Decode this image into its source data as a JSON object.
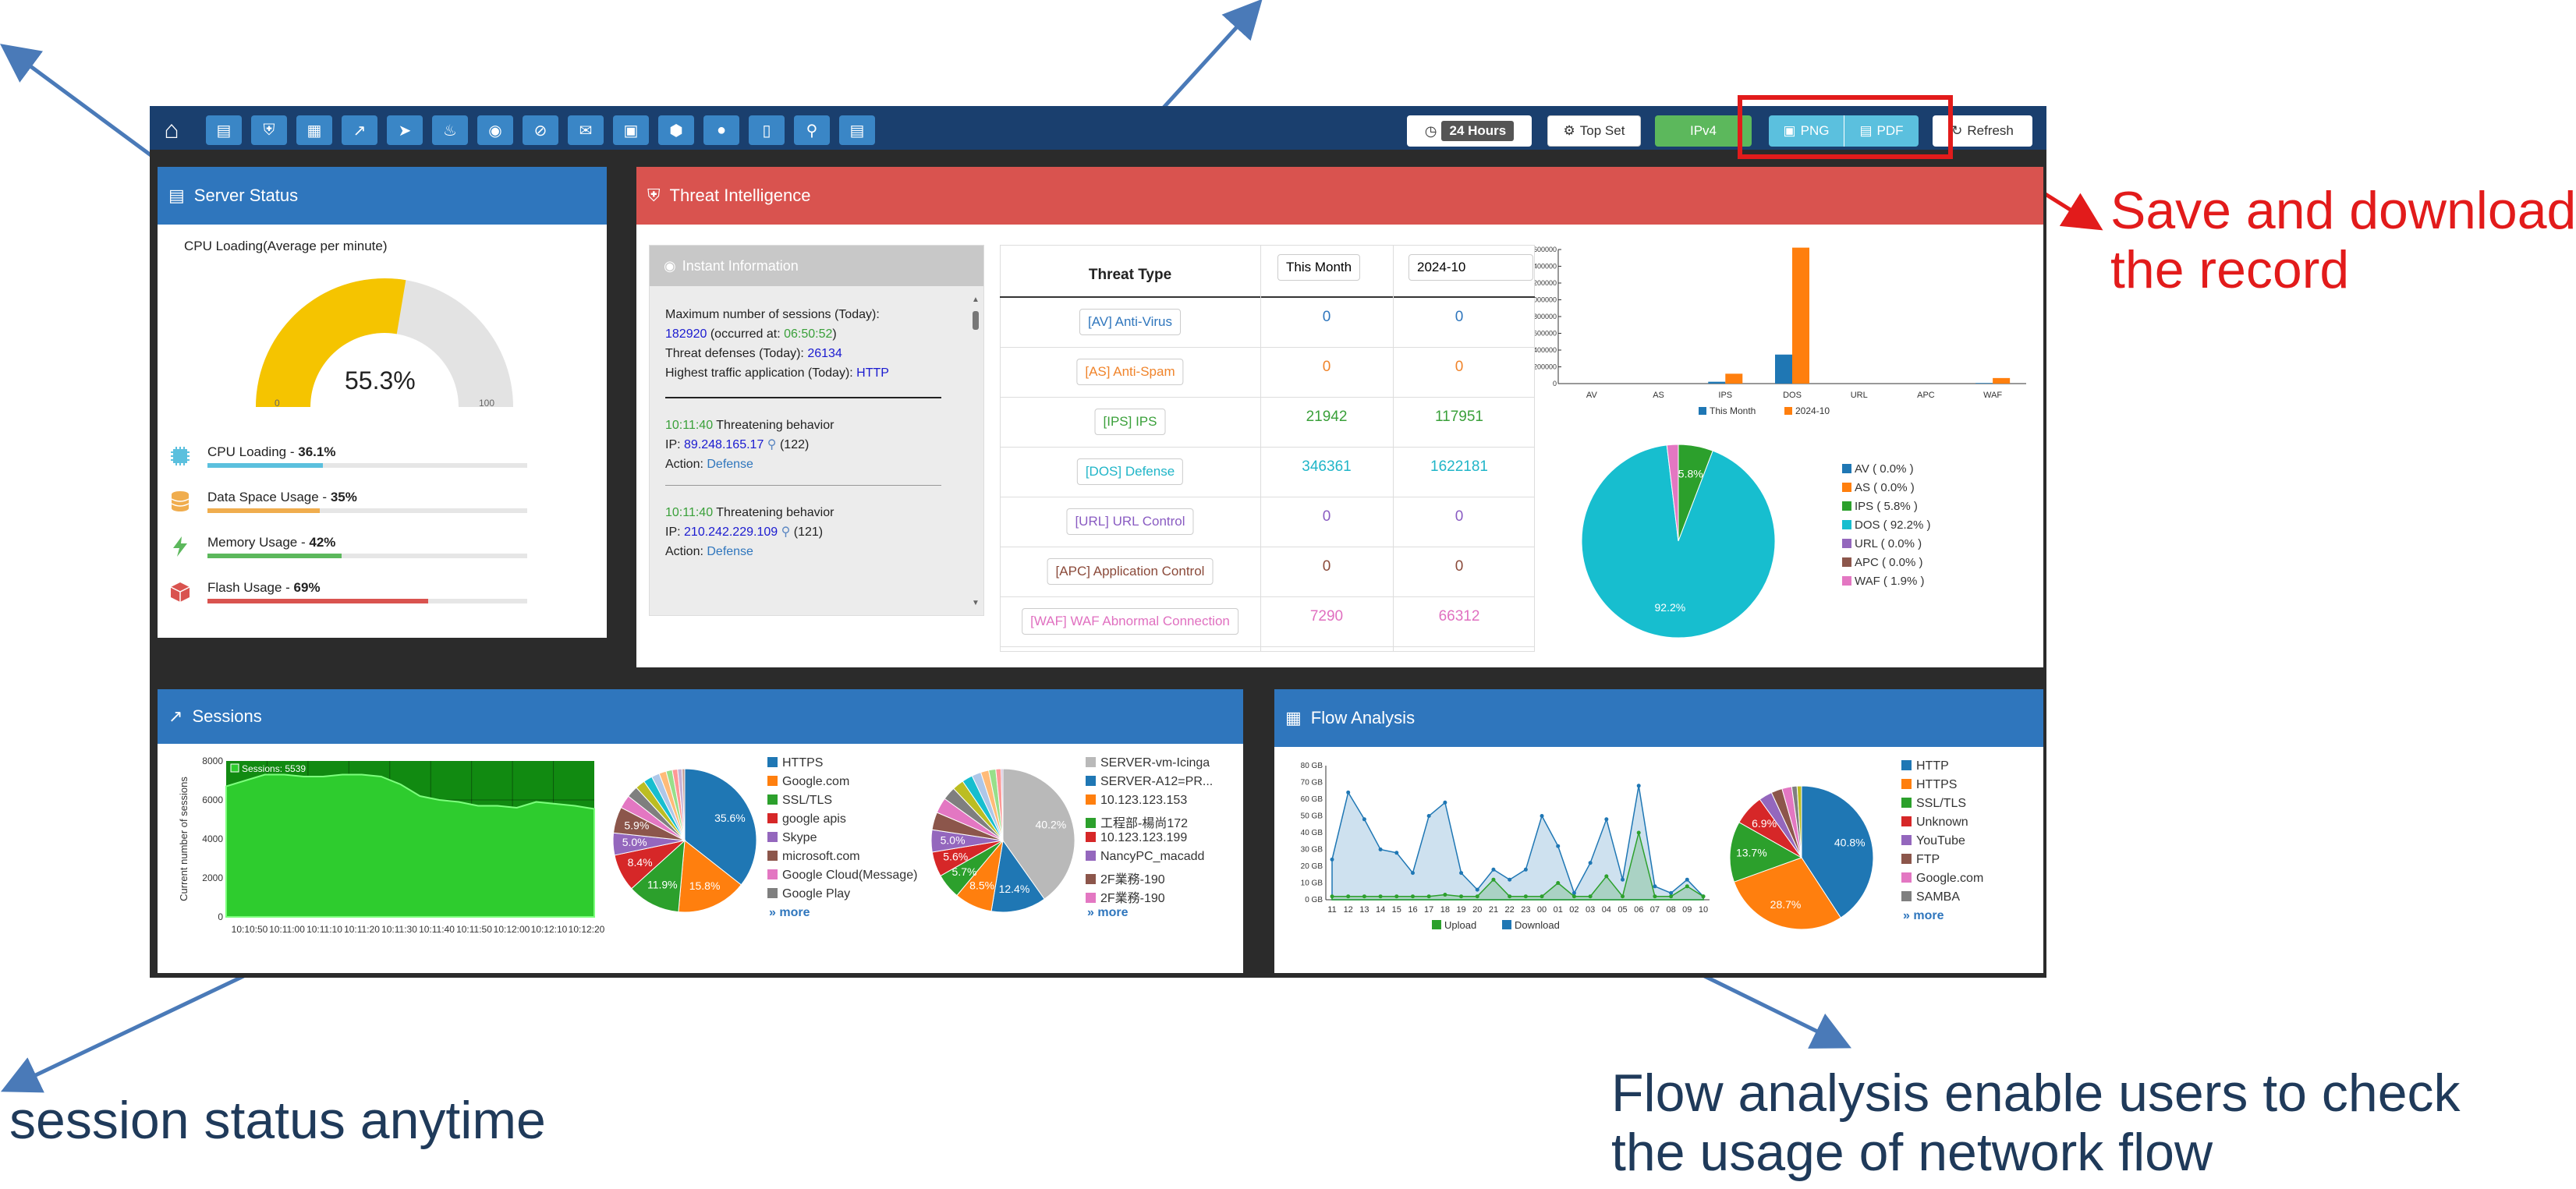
{
  "annotations": {
    "save_download": "Save and download\nthe record",
    "session_status": "session status anytime",
    "flow_analysis": "Flow analysis enable users to check\nthe usage of network flow"
  },
  "colors": {
    "annotation_red": "#e21b1b",
    "annotation_blue": "#1f3a5a",
    "arrow_blue": "#4a7ab8",
    "navbar": "#1a3f6e",
    "panel_blue": "#2f76bd",
    "panel_red": "#d9534f"
  },
  "toolbar": {
    "icons": [
      "home-icon",
      "server-icon",
      "shield-icon",
      "grid-icon",
      "chart-icon",
      "rocket-icon",
      "fire-icon",
      "globe-icon",
      "eye-slash-icon",
      "mail-icon",
      "box-icon",
      "cube-icon",
      "map-marker-icon",
      "map-icon",
      "search-icon",
      "file-icon"
    ],
    "time_label": "24 Hours",
    "top_set_label": "Top Set",
    "ipv4_label": "IPv4",
    "png_label": "PNG",
    "pdf_label": "PDF",
    "refresh_label": "Refresh"
  },
  "server_status": {
    "title": "Server Status",
    "gauge_caption": "CPU Loading(Average per minute)",
    "gauge_value": "55.3%",
    "gauge_fraction": 0.553,
    "gauge_min": "0",
    "gauge_max": "100",
    "metrics": [
      {
        "label": "CPU Loading - ",
        "value": "36.1%",
        "fraction": 0.361,
        "color": "#5bc0de",
        "icon": "chip-icon"
      },
      {
        "label": "Data Space Usage - ",
        "value": "35%",
        "fraction": 0.35,
        "color": "#f0ad4e",
        "icon": "database-icon"
      },
      {
        "label": "Memory Usage - ",
        "value": "42%",
        "fraction": 0.42,
        "color": "#5cb85c",
        "icon": "bolt-icon"
      },
      {
        "label": "Flash Usage - ",
        "value": "69%",
        "fraction": 0.69,
        "color": "#d9534f",
        "icon": "cube-icon"
      }
    ]
  },
  "threat": {
    "title": "Threat Intelligence",
    "instant": {
      "title": "Instant Information",
      "line1": "Maximum number of sessions (Today):",
      "max_sessions": "182920",
      "occurred_prefix": " (occurred at: ",
      "occurred_time": "06:50:52",
      "occurred_suffix": ")",
      "defenses_label": "Threat defenses (Today): ",
      "defenses_value": "26134",
      "app_label": "Highest traffic application (Today): ",
      "app_value": "HTTP",
      "events": [
        {
          "time": "10:11:40",
          "text": " Threatening behavior",
          "ip_label": "IP: ",
          "ip": "89.248.165.17",
          "count": "(122)",
          "action_label": "Action: ",
          "action": "Defense"
        },
        {
          "time": "10:11:40",
          "text": " Threatening behavior",
          "ip_label": "IP: ",
          "ip": "210.242.229.109",
          "count": "(121)",
          "action_label": "Action: ",
          "action": "Defense"
        }
      ]
    },
    "table": {
      "header_type": "Threat Type",
      "header_month": "This Month",
      "header_prev": "2024-10",
      "rows": [
        {
          "type": "[AV] Anti-Virus",
          "month": "0",
          "prev": "0",
          "color": "#2f76bd"
        },
        {
          "type": "[AS] Anti-Spam",
          "month": "0",
          "prev": "0",
          "color": "#f0842b"
        },
        {
          "type": "[IPS] IPS",
          "month": "21942",
          "prev": "117951",
          "color": "#3aa03a"
        },
        {
          "type": "[DOS] Defense",
          "month": "346361",
          "prev": "1622181",
          "color": "#20b5c8"
        },
        {
          "type": "[URL] URL Control",
          "month": "0",
          "prev": "0",
          "color": "#8a5cc2"
        },
        {
          "type": "[APC] Application Control",
          "month": "0",
          "prev": "0",
          "color": "#8b4a3a"
        },
        {
          "type": "[WAF] WAF Abnormal Connection",
          "month": "7290",
          "prev": "66312",
          "color": "#e070c0"
        }
      ]
    }
  },
  "sessions": {
    "title": "Sessions",
    "ylabel": "Current number of sessions",
    "series_label": "Sessions: 5539",
    "pie1_legend": [
      "HTTPS",
      "Google.com",
      "SSL/TLS",
      "google apis",
      "Skype",
      "microsoft.com",
      "Google Cloud(Message)",
      "Google Play"
    ],
    "pie2_legend": [
      "SERVER-vm-Icinga",
      "SERVER-A12=PR...",
      "10.123.123.153",
      "工程部-楊尚172",
      "10.123.123.199",
      "NancyPC_macadd",
      "2F業務-190",
      "2F業務-190"
    ],
    "more": "» more"
  },
  "flow": {
    "title": "Flow Analysis",
    "legend_upload": "Upload",
    "legend_download": "Download",
    "pie_legend": [
      "HTTP",
      "HTTPS",
      "SSL/TLS",
      "Unknown",
      "YouTube",
      "FTP",
      "Google.com",
      "SAMBA"
    ],
    "more": "» more"
  },
  "chart_data": [
    {
      "type": "bar",
      "categories": [
        "AV",
        "AS",
        "IPS",
        "DOS",
        "URL",
        "APC",
        "WAF"
      ],
      "series": [
        {
          "name": "This Month",
          "values": [
            0,
            0,
            21942,
            346361,
            0,
            0,
            7290
          ],
          "color": "#1f77b4"
        },
        {
          "name": "2024-10",
          "values": [
            0,
            0,
            117951,
            1622181,
            0,
            0,
            66312
          ],
          "color": "#ff7f0e"
        }
      ],
      "yticks": [
        "1600000",
        "1400000",
        "1200000",
        "1000000",
        "800000",
        "600000",
        "400000",
        "200000",
        "0"
      ],
      "ylim": [
        0,
        1600000
      ]
    },
    {
      "type": "pie",
      "labels": [
        "AV",
        "AS",
        "IPS",
        "DOS",
        "URL",
        "APC",
        "WAF"
      ],
      "legend": [
        "AV ( 0.0% )",
        "AS ( 0.0% )",
        "IPS ( 5.8% )",
        "DOS ( 92.2% )",
        "URL ( 0.0% )",
        "APC ( 0.0% )",
        "WAF ( 1.9% )"
      ],
      "values": [
        0.0,
        0.0,
        5.8,
        92.2,
        0.0,
        0.0,
        1.9
      ],
      "colors": [
        "#1f77b4",
        "#ff7f0e",
        "#2ca02c",
        "#17becf",
        "#9467bd",
        "#8c564b",
        "#e377c2"
      ],
      "slice_labels": [
        "",
        "",
        "5.8%",
        "92.2%",
        "",
        "",
        ""
      ]
    },
    {
      "type": "area",
      "x": [
        "10:10:50",
        "10:11:00",
        "10:11:10",
        "10:11:20",
        "10:11:30",
        "10:11:40",
        "10:11:50",
        "10:12:00",
        "10:12:10",
        "10:12:20"
      ],
      "xticks": [
        "10:10:50",
        "10:11:00",
        "10:11:10",
        "10:11:20",
        "10:11:30",
        "10:11:40",
        "10:11:50",
        "10:12:00",
        "10:12:10",
        "10:12:20"
      ],
      "yticks": [
        "8000",
        "6000",
        "4000",
        "2000",
        "0"
      ],
      "ylim": [
        0,
        8000
      ],
      "series": [
        {
          "name": "Sessions: 5539",
          "values": [
            6700,
            7000,
            7300,
            7300,
            7200,
            7200,
            7300,
            7300,
            7200,
            6800,
            6200,
            6000,
            5900,
            5700,
            5700,
            5600,
            5900,
            5800,
            5700,
            5539
          ]
        }
      ]
    },
    {
      "type": "pie",
      "values": [
        35.6,
        15.8,
        11.9,
        8.4,
        5.0,
        5.9,
        3.0,
        2.6,
        2.2,
        2.0,
        1.8,
        1.6,
        1.4,
        1.2,
        1.0,
        0.6
      ],
      "slice_labels": [
        "35.6%",
        "15.8%",
        "11.9%",
        "8.4%",
        "5.0%",
        "5.9%",
        "",
        "",
        "",
        "",
        "",
        "",
        "",
        "",
        "",
        ""
      ],
      "colors": [
        "#1f77b4",
        "#ff7f0e",
        "#2ca02c",
        "#d62728",
        "#9467bd",
        "#8c564b",
        "#e377c2",
        "#7f7f7f",
        "#bcbd22",
        "#17becf",
        "#aec7e8",
        "#ffbb78",
        "#98df8a",
        "#ff9896",
        "#c5b0d5",
        "#c49c94"
      ]
    },
    {
      "type": "pie",
      "values": [
        40.2,
        12.4,
        8.5,
        5.7,
        5.6,
        5.0,
        4.0,
        3.5,
        3.0,
        2.6,
        2.4,
        2.1,
        1.8,
        1.6,
        1.2,
        0.4
      ],
      "slice_labels": [
        "40.2%",
        "12.4%",
        "8.5%",
        "5.7%",
        "5.6%",
        "5.0%",
        "",
        "",
        "",
        "",
        "",
        "",
        "",
        "",
        "",
        ""
      ],
      "colors": [
        "#b9b9b9",
        "#1f77b4",
        "#ff7f0e",
        "#2ca02c",
        "#d62728",
        "#9467bd",
        "#8c564b",
        "#e377c2",
        "#7f7f7f",
        "#bcbd22",
        "#17becf",
        "#aec7e8",
        "#ffbb78",
        "#98df8a",
        "#ff9896",
        "#c5b0d5"
      ]
    },
    {
      "type": "area",
      "xticks": [
        "11",
        "12",
        "13",
        "14",
        "15",
        "16",
        "17",
        "18",
        "19",
        "20",
        "21",
        "22",
        "23",
        "00",
        "01",
        "02",
        "03",
        "04",
        "05",
        "06",
        "07",
        "08",
        "09",
        "10"
      ],
      "yticks": [
        "80 GB",
        "70 GB",
        "60 GB",
        "50 GB",
        "40 GB",
        "30 GB",
        "20 GB",
        "10 GB",
        "0 GB"
      ],
      "ylim": [
        0,
        80
      ],
      "series": [
        {
          "name": "Download",
          "values": [
            24,
            64,
            48,
            30,
            28,
            16,
            50,
            58,
            16,
            6,
            18,
            12,
            18,
            50,
            32,
            4,
            22,
            48,
            12,
            68,
            8,
            4,
            12,
            2
          ],
          "color": "#1f77b4"
        },
        {
          "name": "Upload",
          "values": [
            2,
            2,
            2,
            2,
            2,
            2,
            2,
            3,
            2,
            2,
            12,
            2,
            2,
            2,
            10,
            2,
            2,
            14,
            2,
            40,
            2,
            2,
            8,
            2
          ],
          "color": "#2ca02c"
        }
      ]
    },
    {
      "type": "pie",
      "values": [
        40.8,
        28.7,
        13.7,
        6.9,
        3.0,
        2.5,
        2.2,
        1.2,
        1.0
      ],
      "slice_labels": [
        "40.8%",
        "28.7%",
        "13.7%",
        "6.9%",
        "",
        "",
        "",
        "",
        ""
      ],
      "colors": [
        "#1f77b4",
        "#ff7f0e",
        "#2ca02c",
        "#d62728",
        "#9467bd",
        "#8c564b",
        "#e377c2",
        "#7f7f7f",
        "#bcbd22"
      ]
    }
  ]
}
